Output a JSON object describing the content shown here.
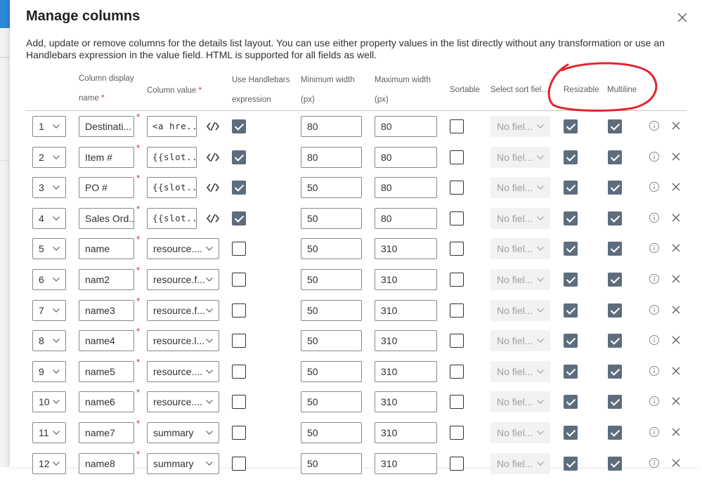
{
  "dialog": {
    "title": "Manage columns",
    "description": "Add, update or remove columns for the details list layout. You can use either property values in the list directly without any transformation or use an Handlebars expression in the value field. HTML is supported for all fields as well."
  },
  "headers": {
    "display_name_1": "Column display",
    "display_name_2": "name",
    "column_value": "Column value",
    "use_hb_1": "Use Handlebars",
    "use_hb_2": "expression",
    "min_width_1": "Minimum width",
    "min_width_2": "(px)",
    "max_width_1": "Maximum width",
    "max_width_2": "(px)",
    "sortable": "Sortable",
    "sort_field": "Select sort field...",
    "resizable": "Resizable",
    "multiline": "Multiline",
    "required_mark": "*"
  },
  "icons": {
    "close": "close-icon",
    "chevron": "chevron-down-icon",
    "handlebars": "code-edit-icon",
    "info": "info-icon",
    "delete": "delete-icon"
  },
  "colors": {
    "checkbox_checked": "#5d6d7e",
    "required": "#c4314b",
    "annotation": "#e0262e",
    "accent": "#2b88d8"
  },
  "rows": [
    {
      "order": "1",
      "name": "Destinati...",
      "value": "<a hre...",
      "value_is_code": true,
      "use_hb": true,
      "min": "80",
      "max": "80",
      "sortable": false,
      "sort_field": "No fiel...",
      "resizable": true,
      "multiline": true
    },
    {
      "order": "2",
      "name": "Item #",
      "value": "{{slot...",
      "value_is_code": true,
      "use_hb": true,
      "min": "80",
      "max": "80",
      "sortable": false,
      "sort_field": "No fiel...",
      "resizable": true,
      "multiline": true
    },
    {
      "order": "3",
      "name": "PO #",
      "value": "{{slot...",
      "value_is_code": true,
      "use_hb": true,
      "min": "50",
      "max": "80",
      "sortable": false,
      "sort_field": "No fiel...",
      "resizable": true,
      "multiline": true
    },
    {
      "order": "4",
      "name": "Sales Ord...",
      "value": "{{slot...",
      "value_is_code": true,
      "use_hb": true,
      "min": "50",
      "max": "80",
      "sortable": false,
      "sort_field": "No fiel...",
      "resizable": true,
      "multiline": true
    },
    {
      "order": "5",
      "name": "name",
      "value": "resource....",
      "value_is_code": false,
      "use_hb": false,
      "min": "50",
      "max": "310",
      "sortable": false,
      "sort_field": "No fiel...",
      "resizable": true,
      "multiline": true
    },
    {
      "order": "6",
      "name": "nam2",
      "value": "resource.f...",
      "value_is_code": false,
      "use_hb": false,
      "min": "50",
      "max": "310",
      "sortable": false,
      "sort_field": "No fiel...",
      "resizable": true,
      "multiline": true
    },
    {
      "order": "7",
      "name": "name3",
      "value": "resource.f...",
      "value_is_code": false,
      "use_hb": false,
      "min": "50",
      "max": "310",
      "sortable": false,
      "sort_field": "No fiel...",
      "resizable": true,
      "multiline": true
    },
    {
      "order": "8",
      "name": "name4",
      "value": "resource.l...",
      "value_is_code": false,
      "use_hb": false,
      "min": "50",
      "max": "310",
      "sortable": false,
      "sort_field": "No fiel...",
      "resizable": true,
      "multiline": true
    },
    {
      "order": "9",
      "name": "name5",
      "value": "resource....",
      "value_is_code": false,
      "use_hb": false,
      "min": "50",
      "max": "310",
      "sortable": false,
      "sort_field": "No fiel...",
      "resizable": true,
      "multiline": true
    },
    {
      "order": "10",
      "name": "name6",
      "value": "resource....",
      "value_is_code": false,
      "use_hb": false,
      "min": "50",
      "max": "310",
      "sortable": false,
      "sort_field": "No fiel...",
      "resizable": true,
      "multiline": true
    },
    {
      "order": "11",
      "name": "name7",
      "value": "summary",
      "value_is_code": false,
      "use_hb": false,
      "min": "50",
      "max": "310",
      "sortable": false,
      "sort_field": "No fiel...",
      "resizable": true,
      "multiline": true
    },
    {
      "order": "12",
      "name": "name8",
      "value": "summary",
      "value_is_code": false,
      "use_hb": false,
      "min": "50",
      "max": "310",
      "sortable": false,
      "sort_field": "No fiel...",
      "resizable": true,
      "multiline": true
    }
  ]
}
